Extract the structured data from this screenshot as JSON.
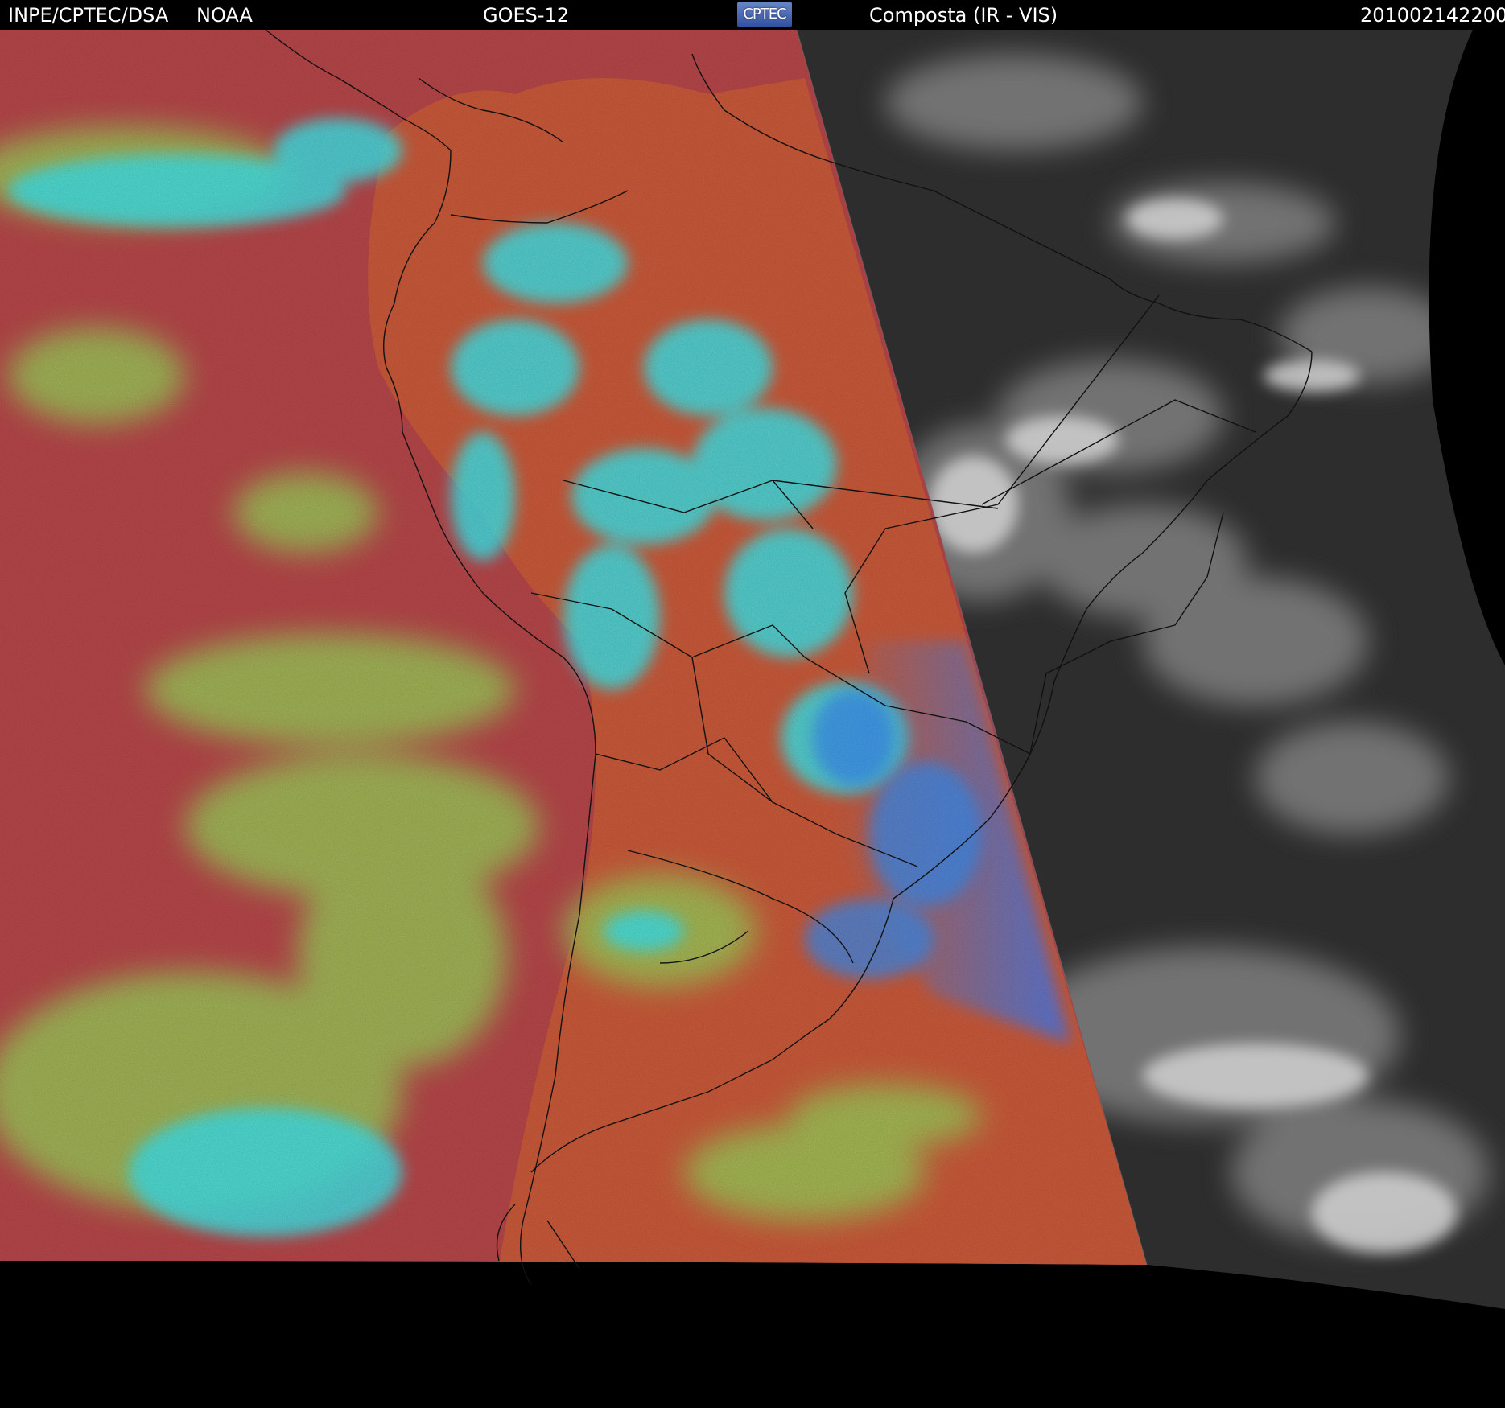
{
  "header": {
    "institution": "INPE/CPTEC/DSA",
    "agency": "NOAA",
    "satellite": "GOES-12",
    "logo_text": "CPTEC",
    "product": "Composta (IR - VIS)",
    "timestamp": "201002142200"
  },
  "colors": {
    "ir_ocean": "#b8474a",
    "ir_land": "#cc5a3a",
    "ir_cloud_low": "#9ccf5a",
    "ir_cloud_high": "#3fe3e8",
    "ir_cloud_cold": "#3a8cf0",
    "vis_background": "#2f2f2f",
    "vis_cloud": "#c8c8c8",
    "space": "#000000"
  },
  "icons": {
    "logo": "cptec-logo"
  }
}
